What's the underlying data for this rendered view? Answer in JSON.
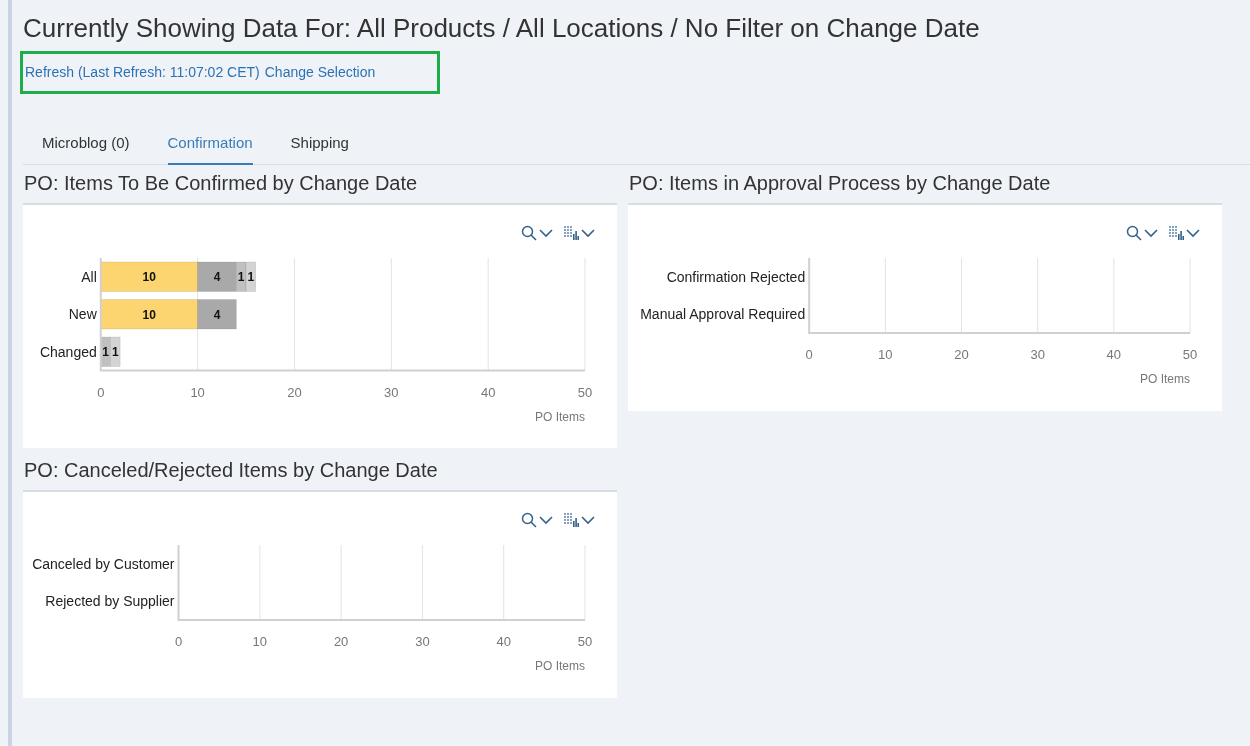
{
  "header": {
    "title": "Currently Showing Data For: All Products / All Locations / No Filter on Change Date",
    "highlighted": true,
    "links": [
      {
        "text": "Refresh (Last Refresh: 11:07:02 CET)"
      },
      {
        "text": "Change Selection"
      }
    ]
  },
  "tabs": [
    {
      "label": "Microblog (0)",
      "selected": false
    },
    {
      "label": "Confirmation",
      "selected": true
    },
    {
      "label": "Shipping",
      "selected": false
    }
  ],
  "charts": [
    {
      "title": "PO: Items To Be Confirmed by Change Date",
      "chart_data": {
        "type": "bar",
        "orientation": "horizontal",
        "stacked": true,
        "data_labels": true,
        "categories": [
          "All",
          "New",
          "Changed"
        ],
        "series": [
          {
            "color": "#fcd470",
            "values": [
              10,
              10,
              null
            ]
          },
          {
            "color": "#a9a9a9",
            "values": [
              4,
              4,
              null
            ]
          },
          {
            "color": "#c0c0c0",
            "values": [
              1,
              null,
              1
            ]
          },
          {
            "color": "#d4d4d4",
            "values": [
              1,
              null,
              1
            ]
          }
        ],
        "grid": true,
        "xlim": [
          0,
          50
        ],
        "xticks": [
          0,
          10,
          20,
          30,
          40,
          50
        ],
        "xlabel": "PO Items"
      }
    },
    {
      "title": "PO: Items in Approval Process by Change Date",
      "chart_data": {
        "type": "bar",
        "orientation": "horizontal",
        "categories": [
          "Confirmation Rejected",
          "Manual Approval Required"
        ],
        "grid": true,
        "xlim": [
          0,
          50
        ],
        "xticks": [
          0,
          10,
          20,
          30,
          40,
          50
        ],
        "xlabel": "PO Items"
      }
    },
    {
      "title": "PO: Canceled/Rejected Items by Change Date",
      "chart_data": {
        "type": "bar",
        "orientation": "horizontal",
        "categories": [
          "Canceled by Customer",
          "Rejected by Supplier"
        ],
        "grid": true,
        "xlim": [
          0,
          50
        ],
        "xticks": [
          0,
          10,
          20,
          30,
          40,
          50
        ],
        "xlabel": "PO Items"
      }
    }
  ]
}
